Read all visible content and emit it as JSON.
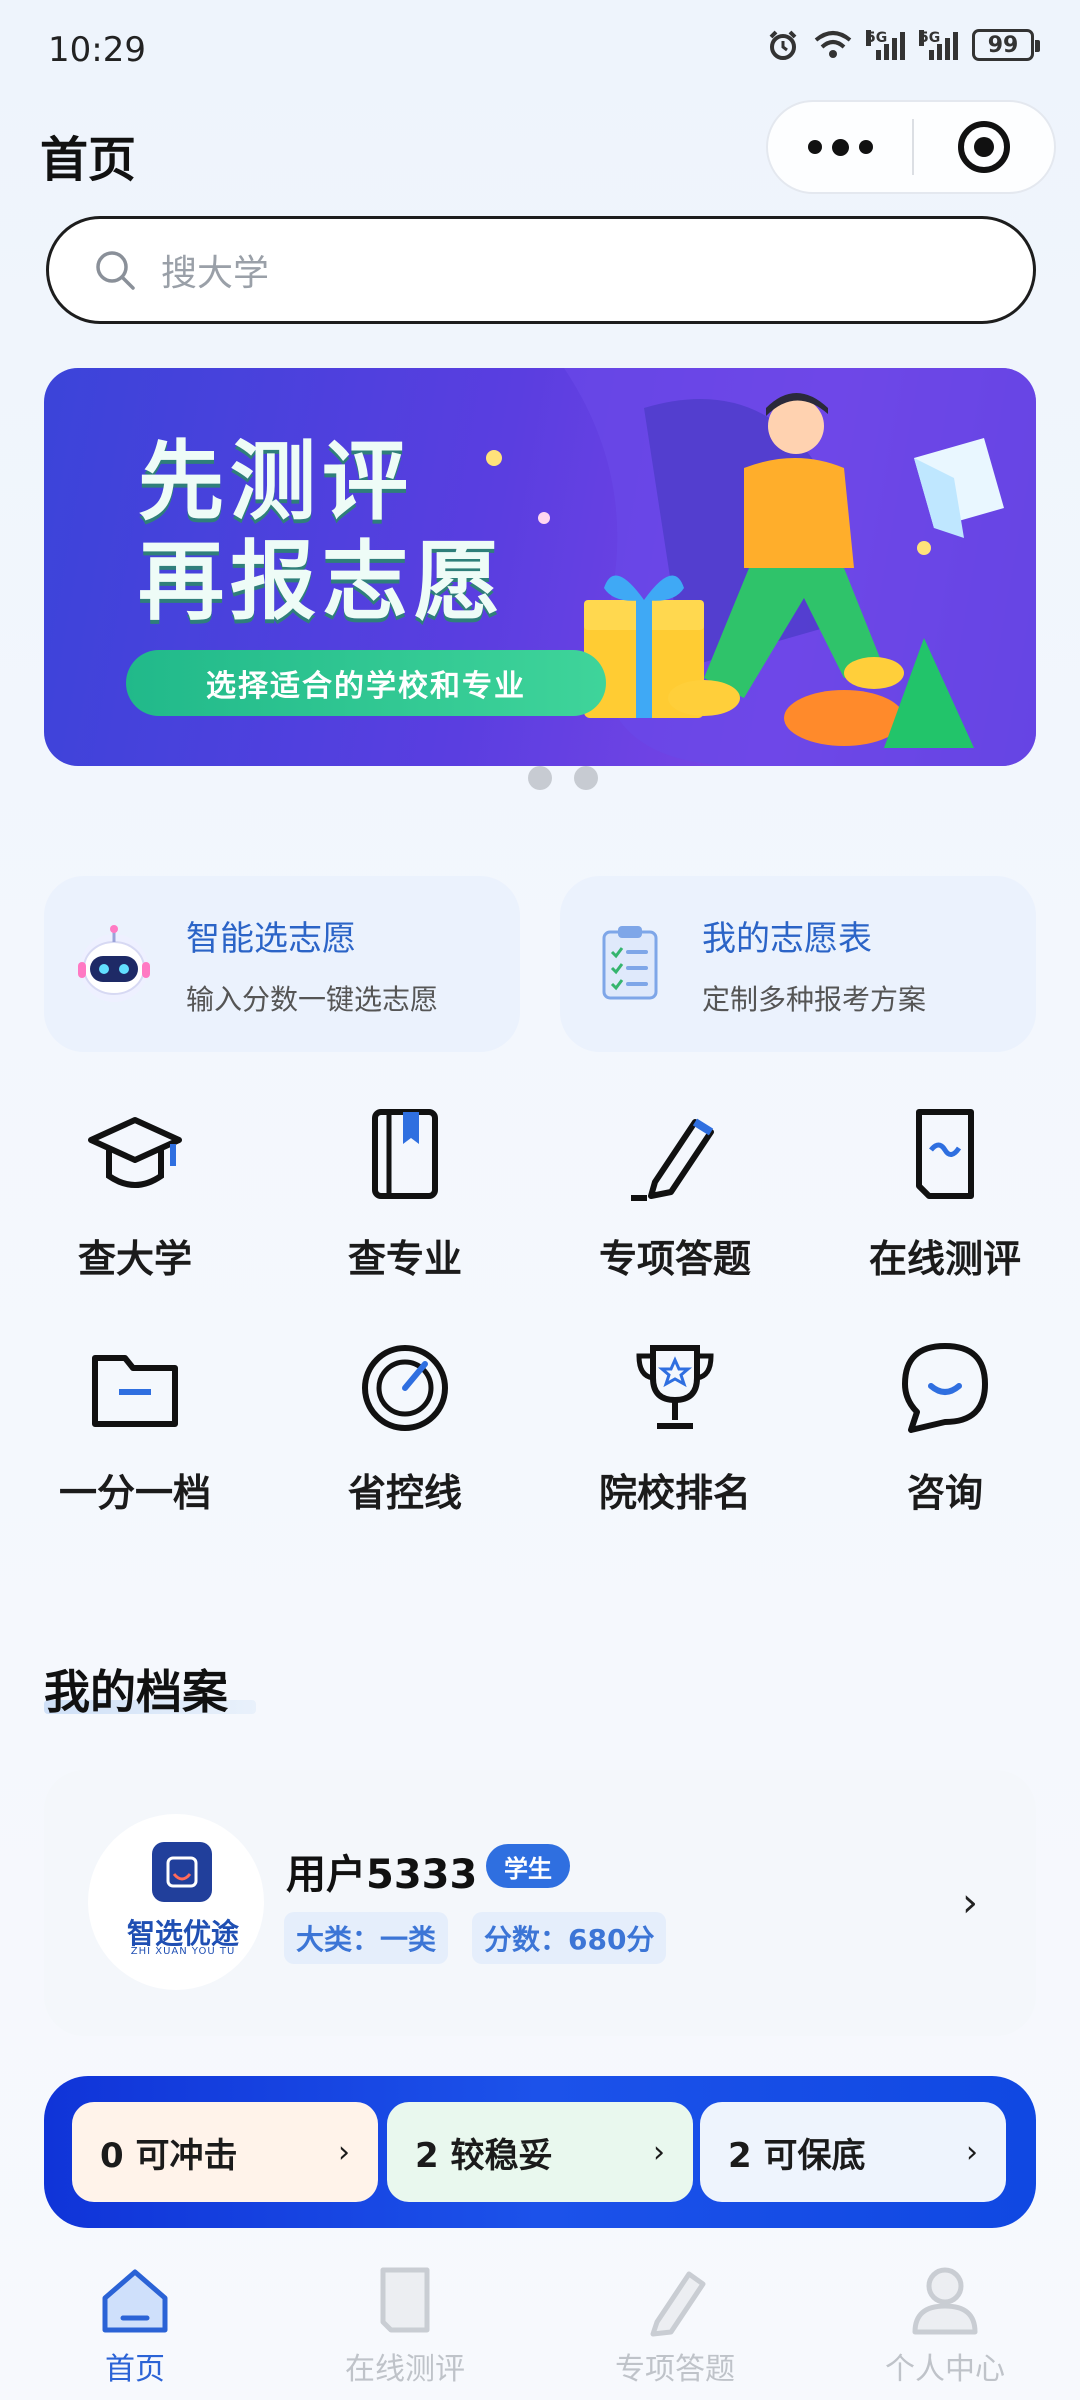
{
  "status_bar": {
    "time": "10:29",
    "battery": "99",
    "sig1": "5G",
    "sig2": "5G"
  },
  "header": {
    "title": "首页"
  },
  "search": {
    "placeholder": "搜大学"
  },
  "banner": {
    "line1": "先测评",
    "line2": "再报志愿",
    "pill": "选择适合的学校和专业",
    "pages": 2,
    "active_page": 0
  },
  "features": [
    {
      "title": "智能选志愿",
      "subtitle": "输入分数一键选志愿",
      "icon": "robot-icon"
    },
    {
      "title": "我的志愿表",
      "subtitle": "定制多种报考方案",
      "icon": "checklist-icon"
    }
  ],
  "grid": [
    {
      "label": "查大学",
      "icon": "graduation-cap-icon"
    },
    {
      "label": "查专业",
      "icon": "book-icon"
    },
    {
      "label": "专项答题",
      "icon": "pencil-icon"
    },
    {
      "label": "在线测评",
      "icon": "document-icon"
    },
    {
      "label": "一分一档",
      "icon": "folder-icon"
    },
    {
      "label": "省控线",
      "icon": "gauge-icon"
    },
    {
      "label": "院校排名",
      "icon": "trophy-icon"
    },
    {
      "label": "咨询",
      "icon": "chat-bubble-icon"
    }
  ],
  "profile": {
    "section_title": "我的档案",
    "logo_text": "智选优途",
    "logo_sub": "ZHI XUAN YOU TU",
    "username": "用户5333",
    "role": "学生",
    "category": "大类：一类",
    "score": "分数：680分",
    "chevron": "›"
  },
  "stats": [
    {
      "label": "0 可冲击",
      "bg": "#fff3ea"
    },
    {
      "label": "2 较稳妥",
      "bg": "#e9f8ee"
    },
    {
      "label": "2 可保底",
      "bg": "#eef4fd"
    }
  ],
  "tabs": [
    {
      "label": "首页",
      "icon": "home-icon",
      "active": true
    },
    {
      "label": "在线测评",
      "icon": "document-icon",
      "active": false
    },
    {
      "label": "专项答题",
      "icon": "pencil-icon",
      "active": false
    },
    {
      "label": "个人中心",
      "icon": "user-icon",
      "active": false
    }
  ],
  "colors": {
    "accent": "#2b63d6",
    "stats_bar": "#1c52ea",
    "feature_title": "#2b64c7"
  }
}
